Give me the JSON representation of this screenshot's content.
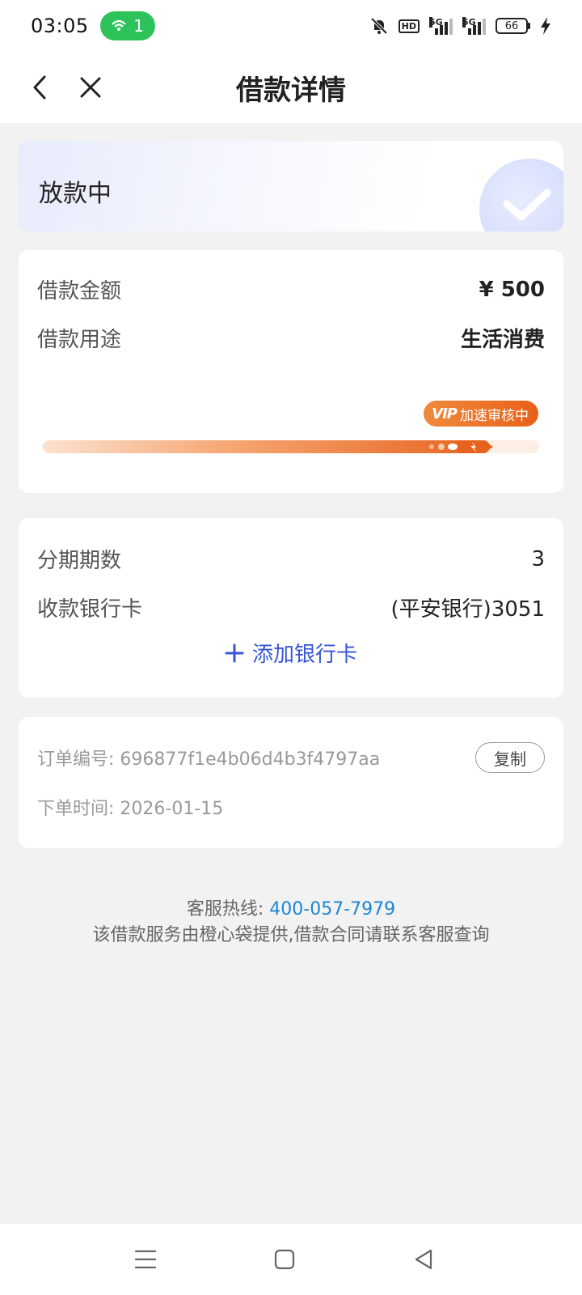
{
  "status_bar": {
    "time": "03:05",
    "hotspot_count": "1",
    "net1": "5G",
    "net2": "5G",
    "battery": "66"
  },
  "nav": {
    "title": "借款详情",
    "back_icon": "chevron-left-icon",
    "close_icon": "close-icon"
  },
  "status_card": {
    "text": "放款中",
    "icon": "check-icon"
  },
  "loan": {
    "amount_label": "借款金额",
    "amount_value": "¥ 500",
    "purpose_label": "借款用途",
    "purpose_value": "生活消费",
    "vip_logo": "VIP",
    "vip_text": "加速审核中",
    "progress": 0.9
  },
  "bank": {
    "installments_label": "分期期数",
    "installments_value": "3",
    "card_label": "收款银行卡",
    "card_value": "(平安银行)3051",
    "add_card_label": "添加银行卡"
  },
  "order": {
    "number_label": "订单编号:",
    "number_value": "696877f1e4b06d4b3f4797aa",
    "copy_label": "复制",
    "time_label": "下单时间:",
    "time_value": "2026-01-15"
  },
  "footer": {
    "hotline_label": "客服热线:",
    "hotline_number": "400-057-7979",
    "note": "该借款服务由橙心袋提供,借款合同请联系客服查询"
  },
  "colors": {
    "accent_blue": "#3556d6",
    "hotline_blue": "#1d86d4",
    "orange": "#e6631f",
    "green": "#2ec25b"
  }
}
